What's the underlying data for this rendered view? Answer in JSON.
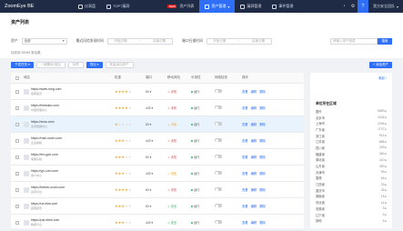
{
  "app": {
    "title": "ZoomEye BE"
  },
  "nav": {
    "items": [
      {
        "label": "仪表盘",
        "active": false
      },
      {
        "label": "TOP7漏洞",
        "active": false
      }
    ],
    "new_badge": "NEW",
    "asset_list": "资产列表",
    "asset_manage": "资产管理",
    "right_items": [
      "漏洞管理",
      "事件管理"
    ],
    "user": "我方安全团队"
  },
  "page": {
    "title": "资产列表"
  },
  "filters": {
    "asset_label": "资产",
    "asset_value": "全部",
    "last_scan_label": "最近风险发现时间",
    "start_placeholder": "开始日期",
    "to": "~",
    "end_placeholder": "结束日期",
    "port_scan_label": "端口扫描时间",
    "search_placeholder": "请输入资产信息",
    "search_button": "搜索",
    "found_text": "找到到 25098 条结果"
  },
  "toolbar": {
    "buttons": [
      {
        "label": "下发任务",
        "style": "primary"
      },
      {
        "label": "一键删除/追加",
        "style": "default"
      },
      {
        "label": "标签",
        "style": "default"
      },
      {
        "label": "导出",
        "style": "primary"
      },
      {
        "label": "批量添加资产",
        "style": "default"
      }
    ],
    "right_button": "添加资产"
  },
  "table": {
    "headers": [
      "域名",
      "权重",
      "端口",
      "移动风险",
      "可用性",
      "网络检查",
      "操作"
    ],
    "rows": [
      {
        "url": "https://www.rong.com",
        "sub": "官网首页",
        "stars": 4,
        "port": "80 ▾",
        "danger": "未知",
        "dcolor": "#e04a4a",
        "status": "运行",
        "scolor": "#2db55d",
        "monitor": false,
        "highlight": false
      },
      {
        "url": "https://linkeabc.com",
        "sub": "内容管理中心",
        "stars": 4,
        "port": "443 ▾",
        "danger": "未知",
        "dcolor": "#e04a4a",
        "status": "运行",
        "scolor": "#2db55d",
        "monitor": false,
        "highlight": false
      },
      {
        "url": "https://znos.com",
        "sub": "业务数据中心",
        "stars": 1,
        "port": "80 ▾",
        "danger": "中危",
        "dcolor": "#f5a623",
        "status": "运行",
        "scolor": "#2db55d",
        "monitor": false,
        "highlight": true
      },
      {
        "url": "https://mail.ocom.com",
        "sub": "企业邮箱",
        "stars": 3,
        "port": "443 ▾",
        "danger": "未知",
        "dcolor": "#e04a4a",
        "status": "运行",
        "scolor": "#2db55d",
        "monitor": false,
        "highlight": false
      },
      {
        "url": "https://em.gob.com",
        "sub": "客服系统",
        "stars": 3,
        "port": "80 ▾",
        "danger": "未知",
        "dcolor": "#e04a4a",
        "status": "运行",
        "scolor": "#2db55d",
        "monitor": false,
        "highlight": false
      },
      {
        "url": "https://yjo.com.com",
        "sub": "用户中心",
        "stars": 3,
        "port": "443 ▾",
        "danger": "低危",
        "dcolor": "#f5a623",
        "status": "运行",
        "scolor": "#2db55d",
        "monitor": false,
        "highlight": false
      },
      {
        "url": "https://beeds.ocom.com",
        "sub": "运营平台",
        "stars": 4,
        "port": "80 ▾",
        "danger": "未知",
        "dcolor": "#e04a4a",
        "status": "运行",
        "scolor": "#2db55d",
        "monitor": false,
        "highlight": false
      },
      {
        "url": "https://ue.nbw.com",
        "sub": "官网首页",
        "stars": 3,
        "port": "80 ▾",
        "danger": "安全",
        "dcolor": "#2db55d",
        "status": "运行",
        "scolor": "#2db55d",
        "monitor": false,
        "highlight": false
      },
      {
        "url": "https://pai.nbmi.com",
        "sub": "数据平台",
        "stars": 3,
        "port": "443 ▾",
        "danger": "安全",
        "dcolor": "#2db55d",
        "status": "运行",
        "scolor": "#2db55d",
        "monitor": false,
        "highlight": false
      }
    ],
    "actions": [
      "查看",
      "编辑",
      "删除"
    ]
  },
  "side": {
    "head_link": "收起 ›",
    "title": "单位所在区域",
    "items": [
      {
        "name": "国外",
        "value": "5683 ▸"
      },
      {
        "name": "北京市",
        "value": "4024 ▸"
      },
      {
        "name": "上海市",
        "value": "2296 ▸"
      },
      {
        "name": "广东省",
        "value": "1737 ▸"
      },
      {
        "name": "浙江省",
        "value": "914 ▸"
      },
      {
        "name": "江苏省",
        "value": "688 ▸"
      },
      {
        "name": "四川省",
        "value": "409 ▸"
      },
      {
        "name": "福建省",
        "value": "360 ▸"
      },
      {
        "name": "湖北省",
        "value": "310 ▸"
      },
      {
        "name": "山东省",
        "value": "280 ▸"
      },
      {
        "name": "天津市",
        "value": "95 ▸"
      },
      {
        "name": "香港",
        "value": "54 ▸"
      },
      {
        "name": "江西省",
        "value": "33 ▸"
      },
      {
        "name": "重庆市",
        "value": "25 ▸"
      },
      {
        "name": "湖南省",
        "value": "18 ▸"
      },
      {
        "name": "河北省",
        "value": "14 ▸"
      },
      {
        "name": "安徽省",
        "value": "9 ▸"
      },
      {
        "name": "辽宁省",
        "value": "9 ▸"
      },
      {
        "name": "其他",
        "value": "6 ▸"
      }
    ]
  },
  "colors": {
    "topbar": "#1f2a44",
    "accent": "#2f6ff7",
    "highlight_row": "#e8f3fd"
  }
}
